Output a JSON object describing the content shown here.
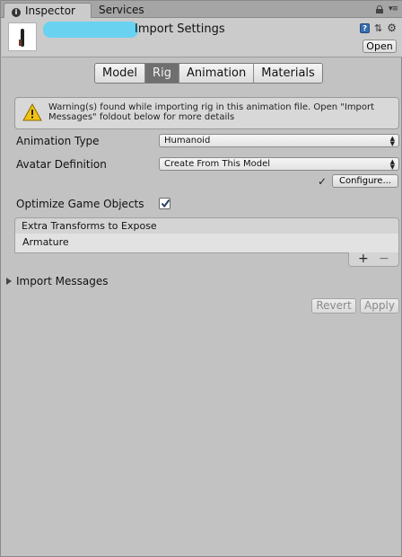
{
  "tabs": {
    "inspector": "Inspector",
    "services": "Services"
  },
  "header": {
    "title": "Import Settings",
    "open_label": "Open"
  },
  "toolbar": {
    "tabs": [
      "Model",
      "Rig",
      "Animation",
      "Materials"
    ],
    "selected": "Rig"
  },
  "warning": {
    "text": "Warning(s) found while importing rig in this animation file. Open \"Import Messages\" foldout below for more details"
  },
  "animation_type": {
    "label": "Animation Type",
    "value": "Humanoid"
  },
  "avatar_definition": {
    "label": "Avatar Definition",
    "value": "Create From This Model"
  },
  "configure": {
    "check": "✓",
    "label": "Configure..."
  },
  "optimize": {
    "label": "Optimize Game Objects",
    "checked": true
  },
  "extra_transforms": {
    "header": "Extra Transforms to Expose",
    "items": [
      "Armature"
    ],
    "add": "+",
    "remove": "−"
  },
  "import_messages": {
    "label": "Import Messages"
  },
  "actions": {
    "revert": "Revert",
    "apply": "Apply"
  },
  "icons": {
    "info": "info-icon",
    "lock": "lock-icon",
    "menu": "menu-icon",
    "help": "help-icon",
    "preset": "preset-icon",
    "gear": "gear-icon",
    "warning": "warning-icon"
  }
}
